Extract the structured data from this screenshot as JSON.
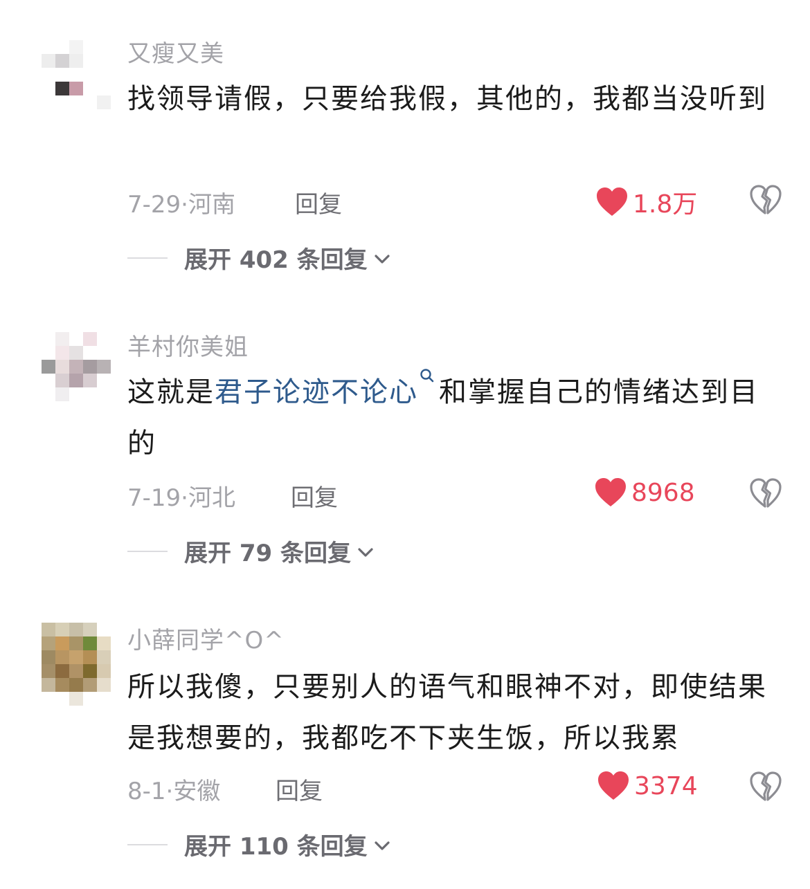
{
  "comments": [
    {
      "username": "又瘦又美",
      "content_parts": [
        "找领导请假，只要给我假，其他的，我都当没听到"
      ],
      "date": "7-29",
      "location": "河南",
      "reply_label": "回复",
      "likes": "1.8万",
      "expand_label": "展开 402 条回复"
    },
    {
      "username": "羊村你美姐",
      "content_before": "这就是",
      "content_link": "君子论迹不论心",
      "content_after": "和掌握自己的情绪达到目的",
      "date": "7-19",
      "location": "河北",
      "reply_label": "回复",
      "likes": "8968",
      "expand_label": "展开 79 条回复"
    },
    {
      "username": "小薛同学^O^",
      "content_parts": [
        "所以我傻，只要别人的语气和眼神不对，即使结果是我想要的，我都吃不下夹生饭，所以我累"
      ],
      "date": "8-1",
      "location": "安徽",
      "reply_label": "回复",
      "likes": "3374",
      "expand_label": "展开 110 条回复"
    }
  ],
  "meta_separator": "·",
  "colors": {
    "like": "#e8465a",
    "link": "#2e5a8c",
    "muted": "#a3a3a8"
  },
  "icons": {
    "like": "heart-icon",
    "dislike": "broken-heart-icon",
    "expand": "chevron-down-icon",
    "link": "search-icon"
  }
}
